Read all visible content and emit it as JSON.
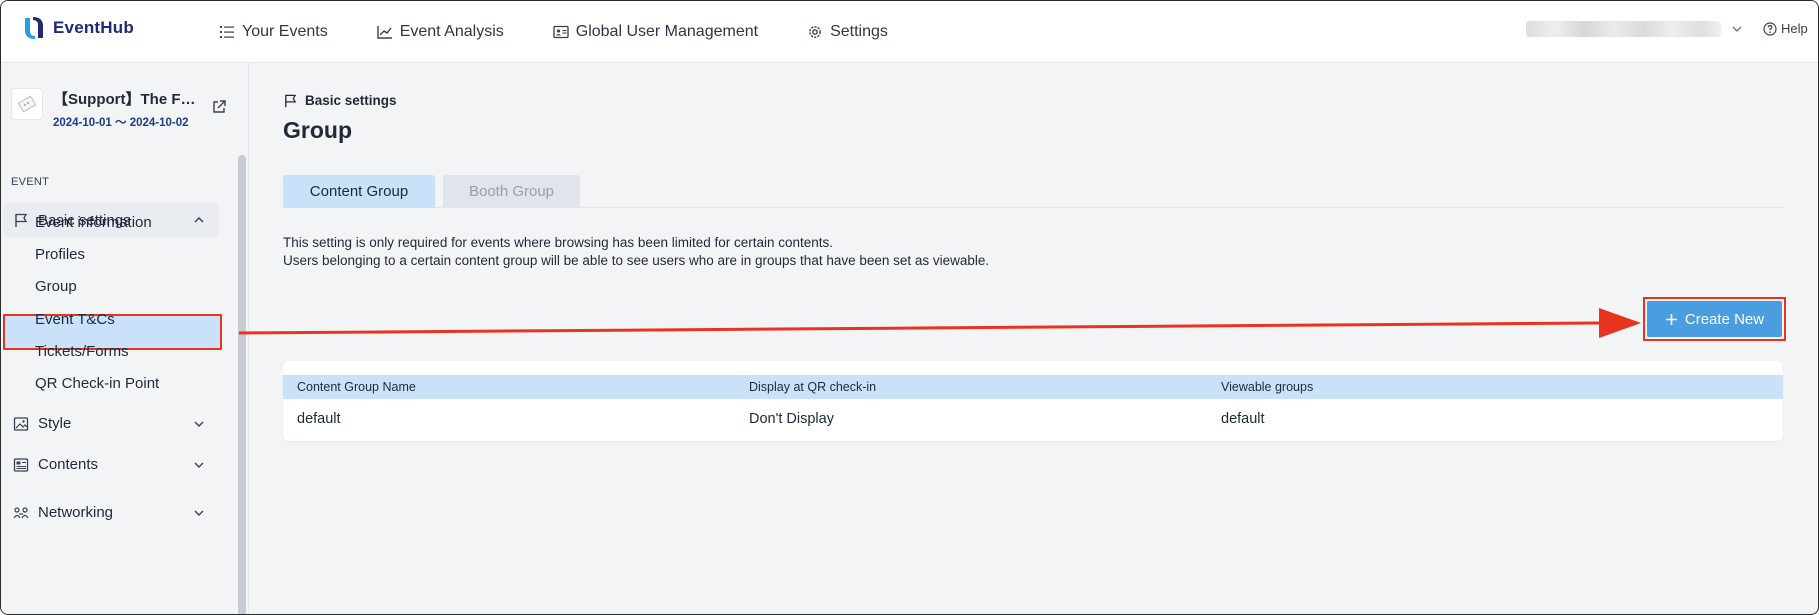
{
  "app": {
    "name": "EventHub"
  },
  "nav": {
    "items": [
      {
        "label": "Your Events",
        "icon": "list-icon"
      },
      {
        "label": "Event Analysis",
        "icon": "chart-line-icon"
      },
      {
        "label": "Global User Management",
        "icon": "id-card-icon"
      },
      {
        "label": "Settings",
        "icon": "gear-icon"
      }
    ],
    "help_label": "Help"
  },
  "event": {
    "title": "【Support】The F…",
    "dates": "2024-10-01 ～ 2024-10-02"
  },
  "sidebar": {
    "section_label": "EVENT",
    "group_label": "Basic settings",
    "sub_items": [
      "Event information",
      "Profiles",
      "Group",
      "Event T&Cs",
      "Tickets/Forms",
      "QR Check-in Point"
    ],
    "active_item": "Group",
    "collapsed": [
      {
        "label": "Style",
        "icon": "image-icon"
      },
      {
        "label": "Contents",
        "icon": "newspaper-icon"
      },
      {
        "label": "Networking",
        "icon": "people-link-icon"
      }
    ]
  },
  "main": {
    "breadcrumb": "Basic settings",
    "title": "Group",
    "tabs": [
      {
        "label": "Content Group",
        "active": true
      },
      {
        "label": "Booth Group",
        "active": false
      }
    ],
    "description": [
      "This setting is only required for events where browsing has been limited for certain contents.",
      "Users belonging to a certain content group will be able to see users who are in groups that have been set as viewable."
    ],
    "create_button": "Create New",
    "table": {
      "headers": [
        "Content Group Name",
        "Display at QR check-in",
        "Viewable groups"
      ],
      "rows": [
        [
          "default",
          "Don't Display",
          "default"
        ]
      ]
    }
  },
  "colors": {
    "accent_blue": "#4a9ee0",
    "active_bg": "#c9e2fa",
    "annotation_red": "#e8331e",
    "brand_navy": "#1e2a78"
  }
}
